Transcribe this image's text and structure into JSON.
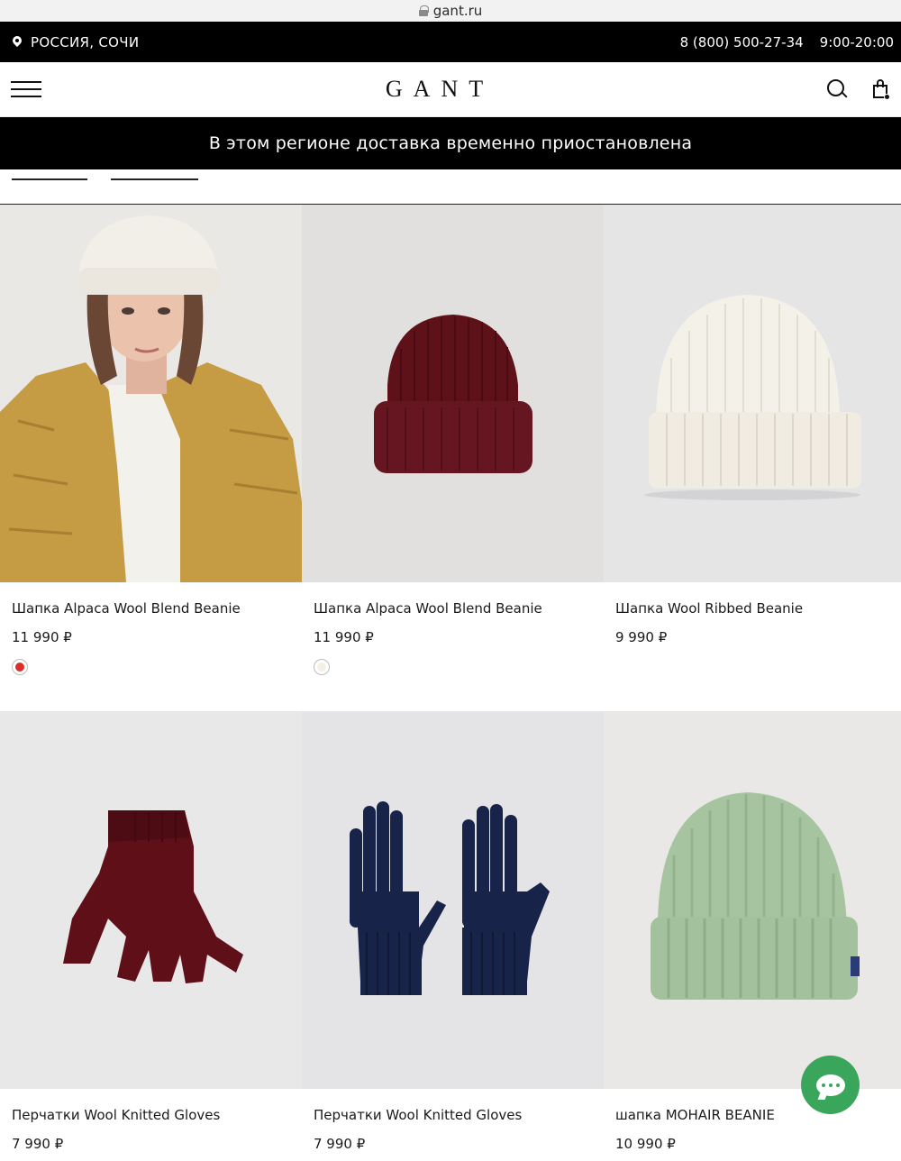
{
  "browser": {
    "url": "gant.ru"
  },
  "topbar": {
    "location": "РОССИЯ, СОЧИ",
    "phone": "8 (800) 500-27-34",
    "hours": "9:00-20:00"
  },
  "header": {
    "logo": "GANT",
    "icons": [
      "menu-icon",
      "search-icon",
      "bag-icon"
    ]
  },
  "notice": {
    "text": "В этом регионе доставка временно приостановлена"
  },
  "products": [
    {
      "name": "Шапка Alpaca Wool Blend Beanie",
      "price": "11 990 ₽",
      "swatch": "#d9302a"
    },
    {
      "name": "Шапка Alpaca Wool Blend Beanie",
      "price": "11 990 ₽",
      "swatch": "#f5f0e4"
    },
    {
      "name": "Шапка Wool Ribbed Beanie",
      "price": "9 990 ₽"
    },
    {
      "name": "Перчатки Wool Knitted Gloves",
      "price": "7 990 ₽"
    },
    {
      "name": "Перчатки Wool Knitted Gloves",
      "price": "7 990 ₽"
    },
    {
      "name": "шапка MOHAIR BEANIE",
      "price": "10 990 ₽"
    }
  ],
  "colors": {
    "brand_black": "#000000",
    "chat_green": "#3aa65b"
  }
}
